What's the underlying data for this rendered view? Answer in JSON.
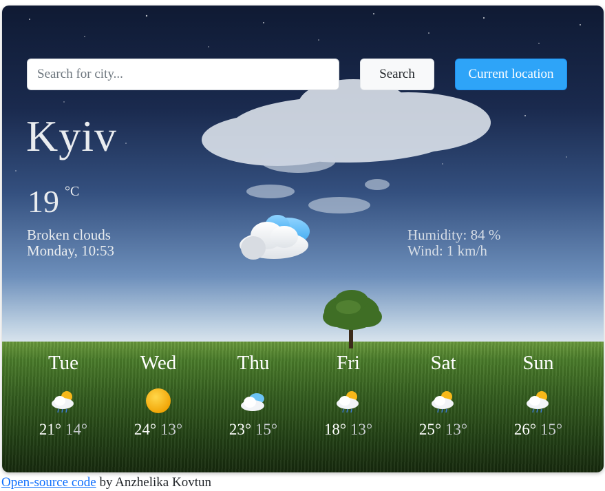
{
  "search": {
    "placeholder": "Search for city...",
    "button_label": "Search",
    "location_label": "Current location"
  },
  "current": {
    "city": "Kyiv",
    "temperature": "19",
    "unit": "°C",
    "description": "Broken clouds",
    "datetime": "Monday, 10:53",
    "humidity": "Humidity: 84 %",
    "wind": "Wind: 1 km/h",
    "icon": "broken-clouds-icon"
  },
  "forecast": [
    {
      "day": "Tue",
      "max": "21°",
      "min": "14°",
      "icon": "sun-rain-cloud-icon"
    },
    {
      "day": "Wed",
      "max": "24°",
      "min": "13°",
      "icon": "sun-icon"
    },
    {
      "day": "Thu",
      "max": "23°",
      "min": "15°",
      "icon": "cloud-icon"
    },
    {
      "day": "Fri",
      "max": "18°",
      "min": "13°",
      "icon": "sun-rain-cloud-icon"
    },
    {
      "day": "Sat",
      "max": "25°",
      "min": "13°",
      "icon": "sun-rain-cloud-icon"
    },
    {
      "day": "Sun",
      "max": "26°",
      "min": "15°",
      "icon": "sun-rain-cloud-icon"
    }
  ],
  "footer": {
    "link_text": "Open-source code",
    "author_text": "by Anzhelika Kovtun"
  },
  "colors": {
    "accent": "#2ea4f8",
    "link": "#0d6efd"
  }
}
